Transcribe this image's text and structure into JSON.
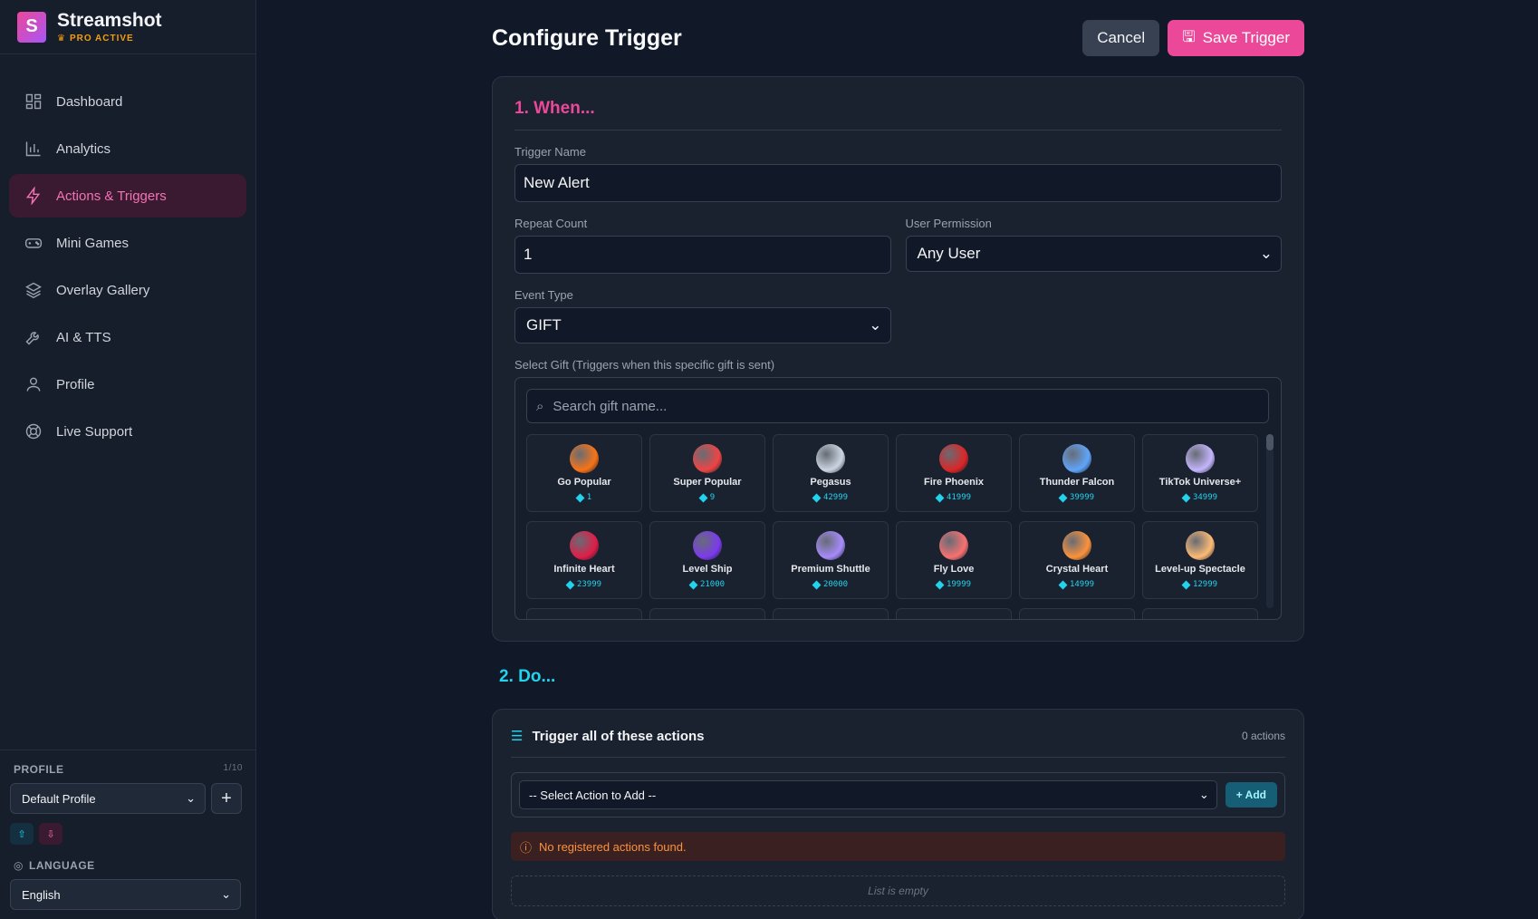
{
  "brand": {
    "logo_letter": "S",
    "name": "Streamshot",
    "badge": "PRO ACTIVE"
  },
  "nav": [
    {
      "label": "Dashboard",
      "icon": "dashboard-icon",
      "active": false
    },
    {
      "label": "Analytics",
      "icon": "analytics-icon",
      "active": false
    },
    {
      "label": "Actions & Triggers",
      "icon": "lightning-icon",
      "active": true
    },
    {
      "label": "Mini Games",
      "icon": "gamepad-icon",
      "active": false
    },
    {
      "label": "Overlay Gallery",
      "icon": "layers-icon",
      "active": false
    },
    {
      "label": "AI & TTS",
      "icon": "wrench-icon",
      "active": false
    },
    {
      "label": "Profile",
      "icon": "user-icon",
      "active": false
    },
    {
      "label": "Live Support",
      "icon": "lifebuoy-icon",
      "active": false
    }
  ],
  "sidebar_bottom": {
    "profile_label": "PROFILE",
    "profile_count": "1/10",
    "profile_value": "Default Profile",
    "language_label": "LANGUAGE",
    "language_value": "English"
  },
  "page": {
    "title": "Configure Trigger",
    "cancel_label": "Cancel",
    "save_label": "Save Trigger"
  },
  "when": {
    "title": "1. When...",
    "trigger_name_label": "Trigger Name",
    "trigger_name_value": "New Alert",
    "repeat_label": "Repeat Count",
    "repeat_value": "1",
    "permission_label": "User Permission",
    "permission_value": "Any User",
    "event_label": "Event Type",
    "event_value": "GIFT",
    "gift_label": "Select Gift (Triggers when this specific gift is sent)",
    "search_placeholder": "Search gift name...",
    "gifts": [
      {
        "name": "Go Popular",
        "price": "1",
        "color": "#f97316"
      },
      {
        "name": "Super Popular",
        "price": "9",
        "color": "#ef4444"
      },
      {
        "name": "Pegasus",
        "price": "42999",
        "color": "#cbd5e1"
      },
      {
        "name": "Fire Phoenix",
        "price": "41999",
        "color": "#dc2626"
      },
      {
        "name": "Thunder Falcon",
        "price": "39999",
        "color": "#60a5fa"
      },
      {
        "name": "TikTok Universe+",
        "price": "34999",
        "color": "#c4b5fd"
      },
      {
        "name": "Infinite Heart",
        "price": "23999",
        "color": "#e11d48"
      },
      {
        "name": "Level Ship",
        "price": "21000",
        "color": "#7c3aed"
      },
      {
        "name": "Premium Shuttle",
        "price": "20000",
        "color": "#a78bfa"
      },
      {
        "name": "Fly Love",
        "price": "19999",
        "color": "#f87171"
      },
      {
        "name": "Crystal Heart",
        "price": "14999",
        "color": "#fb923c"
      },
      {
        "name": "Level-up Spectacle",
        "price": "12999",
        "color": "#fdba74"
      }
    ]
  },
  "do": {
    "title": "2. Do...",
    "card_title": "Trigger all of these actions",
    "count": "0 actions",
    "select_placeholder": "-- Select Action to Add --",
    "add_label": "+ Add",
    "warning": "No registered actions found.",
    "empty": "List is empty"
  }
}
